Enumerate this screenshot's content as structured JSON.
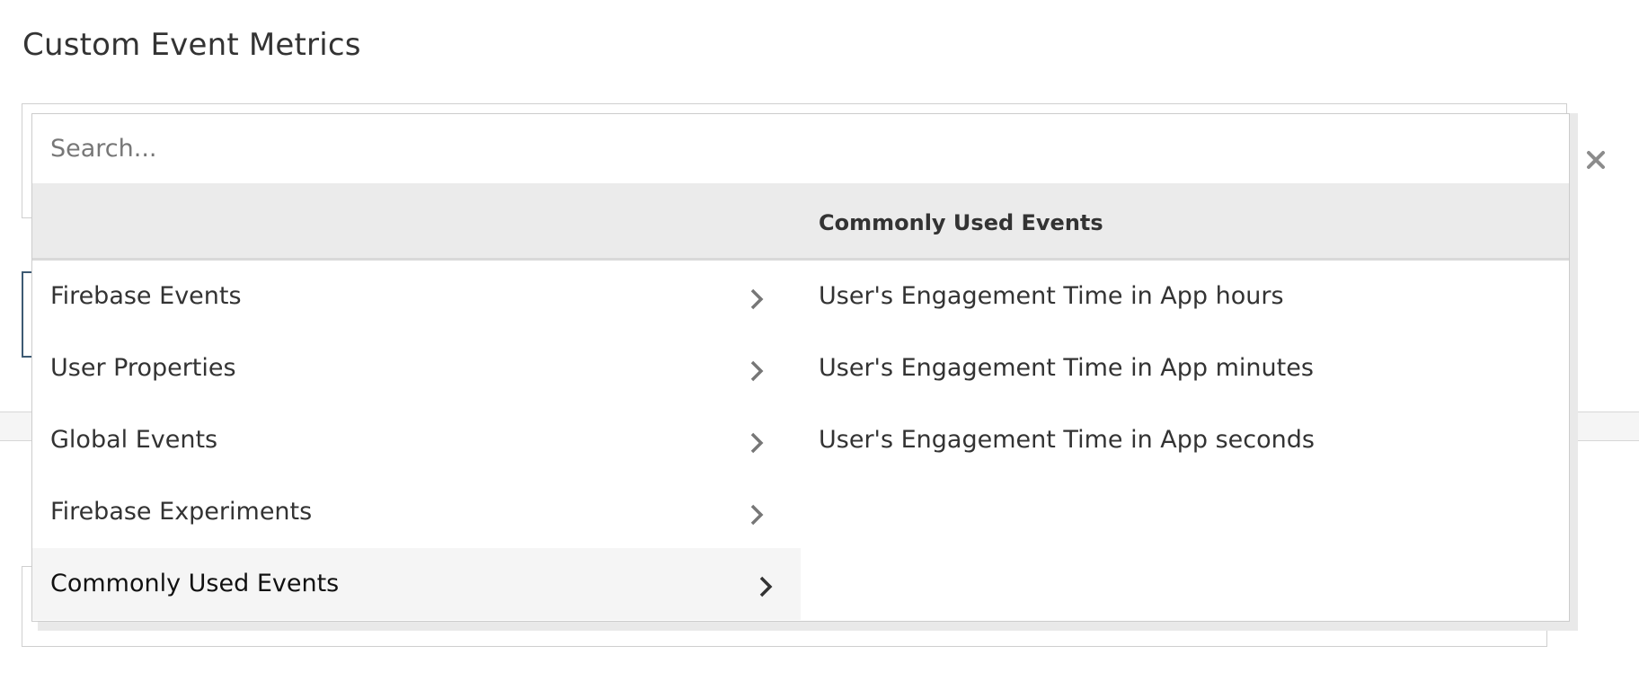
{
  "page": {
    "title": "Custom Event Metrics"
  },
  "search": {
    "placeholder": "Search..."
  },
  "panel": {
    "header_title": "Commonly Used Events"
  },
  "categories": [
    {
      "label": "Firebase Events",
      "active": false
    },
    {
      "label": "User Properties",
      "active": false
    },
    {
      "label": "Global Events",
      "active": false
    },
    {
      "label": "Firebase Experiments",
      "active": false
    },
    {
      "label": "Commonly Used Events",
      "active": true
    }
  ],
  "events": [
    {
      "label": "User's Engagement Time in App hours"
    },
    {
      "label": "User's Engagement Time in App minutes"
    },
    {
      "label": "User's Engagement Time in App seconds"
    }
  ],
  "icons": {
    "close": "close-icon",
    "chevron": "chevron-right-icon"
  },
  "colors": {
    "text": "#333333",
    "header_bg": "#ebebeb",
    "active_bg": "#f5f5f5",
    "focus_border": "#3d5a73"
  }
}
